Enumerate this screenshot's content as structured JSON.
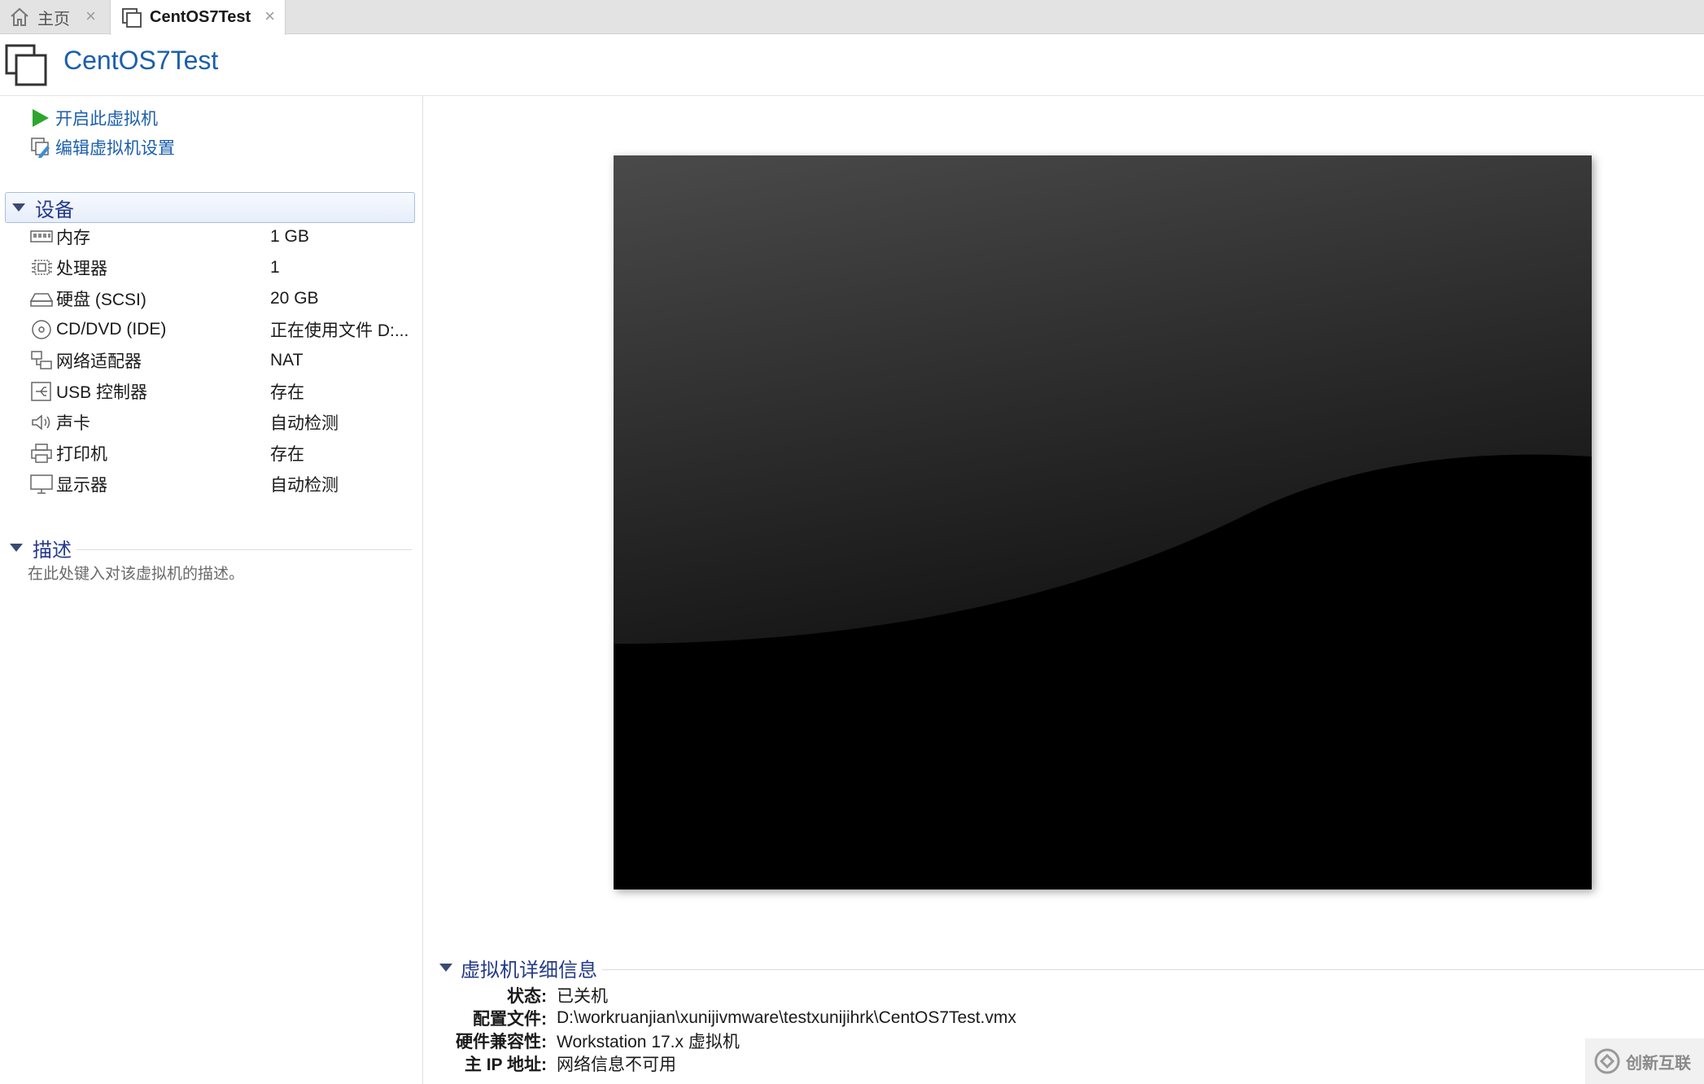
{
  "tabs": [
    {
      "label": "主页",
      "icon": "home-icon"
    },
    {
      "label": "CentOS7Test",
      "icon": "vm-icon"
    }
  ],
  "tab_close_glyph": "×",
  "header": {
    "title": "CentOS7Test"
  },
  "actions": {
    "power_on": "开启此虚拟机",
    "edit_settings": "编辑虚拟机设置"
  },
  "devices": {
    "section_title": "设备",
    "items": [
      {
        "name": "内存",
        "value": "1 GB",
        "icon": "memory-icon"
      },
      {
        "name": "处理器",
        "value": "1",
        "icon": "cpu-icon"
      },
      {
        "name": "硬盘 (SCSI)",
        "value": "20 GB",
        "icon": "hard-disk-icon"
      },
      {
        "name": "CD/DVD (IDE)",
        "value": "正在使用文件 D:...",
        "icon": "cd-dvd-icon"
      },
      {
        "name": "网络适配器",
        "value": "NAT",
        "icon": "network-adapter-icon"
      },
      {
        "name": "USB 控制器",
        "value": "存在",
        "icon": "usb-icon"
      },
      {
        "name": "声卡",
        "value": "自动检测",
        "icon": "speaker-icon"
      },
      {
        "name": "打印机",
        "value": "存在",
        "icon": "printer-icon"
      },
      {
        "name": "显示器",
        "value": "自动检测",
        "icon": "monitor-icon"
      }
    ]
  },
  "description": {
    "section_title": "描述",
    "placeholder": "在此处键入对该虚拟机的描述。"
  },
  "details": {
    "section_title": "虚拟机详细信息",
    "rows": [
      {
        "label": "状态:",
        "value": "已关机"
      },
      {
        "label": "配置文件:",
        "value": "D:\\workruanjian\\xunijivmware\\testxunijihrk\\CentOS7Test.vmx"
      },
      {
        "label": "硬件兼容性:",
        "value": "Workstation 17.x 虚拟机"
      },
      {
        "label": "主 IP 地址:",
        "value": "网络信息不可用"
      }
    ]
  },
  "watermark": {
    "text": "创新互联"
  },
  "colors": {
    "link": "#1b5fad",
    "section": "#243a8a",
    "play": "#2ea62e"
  }
}
